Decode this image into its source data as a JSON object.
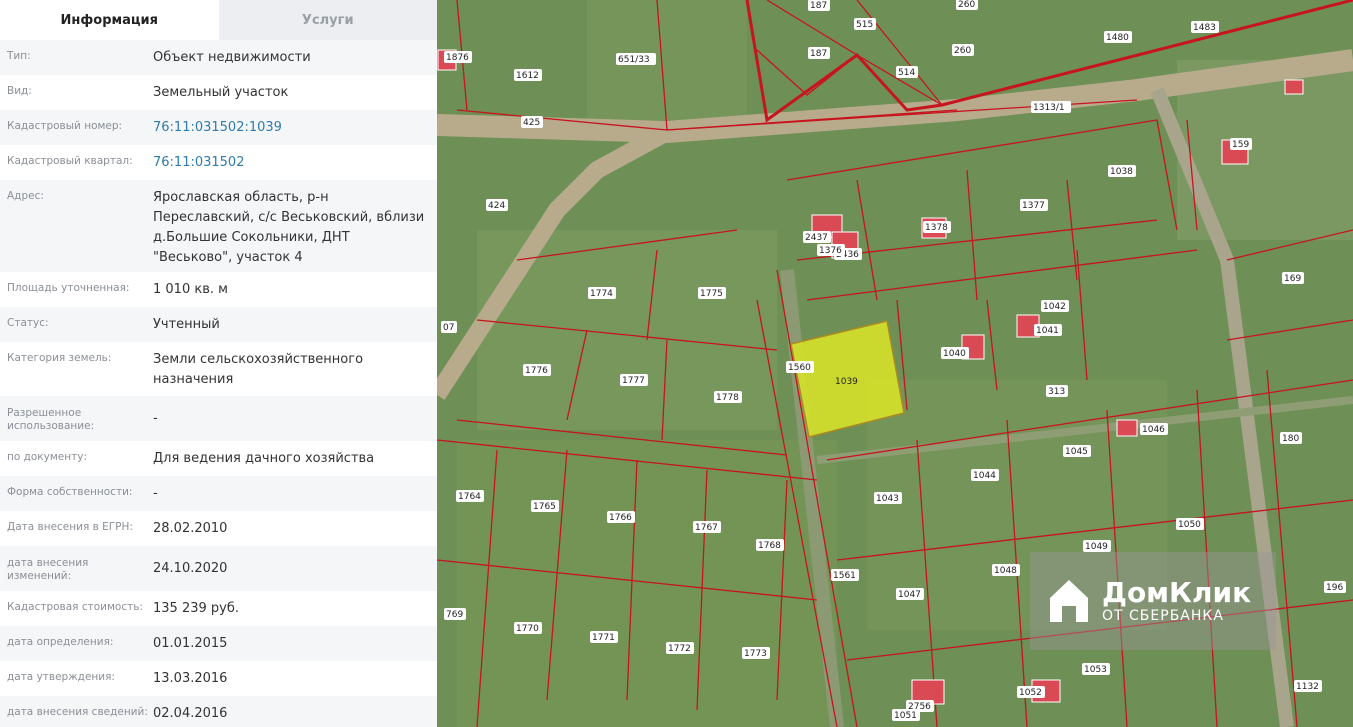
{
  "tabs": [
    {
      "label": "Информация"
    },
    {
      "label": "Услуги"
    }
  ],
  "rows": [
    {
      "key": "Тип:",
      "value": "Объект недвижимости"
    },
    {
      "key": "Вид:",
      "value": "Земельный участок"
    },
    {
      "key": "Кадастровый номер:",
      "value": "76:11:031502:1039"
    },
    {
      "key": "Кадастровый квартал:",
      "value": "76:11:031502"
    },
    {
      "key": "Адрес:",
      "value": "Ярославская область, р-н Переславский, с/с Веськовский, вблизи д.Большие Сокольники, ДНТ \"Веськово\", участок 4"
    },
    {
      "key": "Площадь уточненная:",
      "value": "1 010 кв. м"
    },
    {
      "key": "Статус:",
      "value": "Учтенный"
    },
    {
      "key": "Категория земель:",
      "value": "Земли сельскохозяйственного назначения"
    },
    {
      "key": "Разрешенное использование:",
      "value": "-"
    },
    {
      "key": "по документу:",
      "value": "Для ведения дачного хозяйства"
    },
    {
      "key": "Форма собственности:",
      "value": "-"
    },
    {
      "key": "Дата внесения в ЕГРН:",
      "value": "28.02.2010"
    },
    {
      "key": "дата внесения изменений:",
      "value": "24.10.2020"
    },
    {
      "key": "Кадастровая стоимость:",
      "value": "135 239 руб."
    },
    {
      "key": "дата определения:",
      "value": "01.01.2015"
    },
    {
      "key": "дата утверждения:",
      "value": "13.03.2016"
    },
    {
      "key": "дата внесения сведений:",
      "value": "02.04.2016"
    }
  ],
  "map": {
    "selected_parcel": "1039",
    "selected_color": "#d6e22a",
    "boundary_color": "#c8141e",
    "parcels": [
      "1876",
      "1612",
      "651/33",
      "187",
      "187",
      "515",
      "514",
      "260",
      "260",
      "1480",
      "1483",
      "425",
      "1313/1",
      "1038",
      "159",
      "424",
      "2436",
      "2437",
      "1376",
      "1378",
      "1377",
      "1774",
      "1775",
      "169",
      "1042",
      "1041",
      "1040",
      "1776",
      "1777",
      "1778",
      "1560",
      "313",
      "1046",
      "180",
      "1045",
      "1044",
      "1043",
      "1764",
      "1765",
      "1766",
      "1767",
      "1768",
      "1050",
      "1049",
      "1048",
      "1047",
      "1561",
      "196",
      "769",
      "1770",
      "1771",
      "1772",
      "1773",
      "1053",
      "1132",
      "1052",
      "2756",
      "1051",
      "07"
    ]
  },
  "watermark": {
    "title": "ДомКлик",
    "subtitle": "ОТ СБЕРБАНКА"
  }
}
